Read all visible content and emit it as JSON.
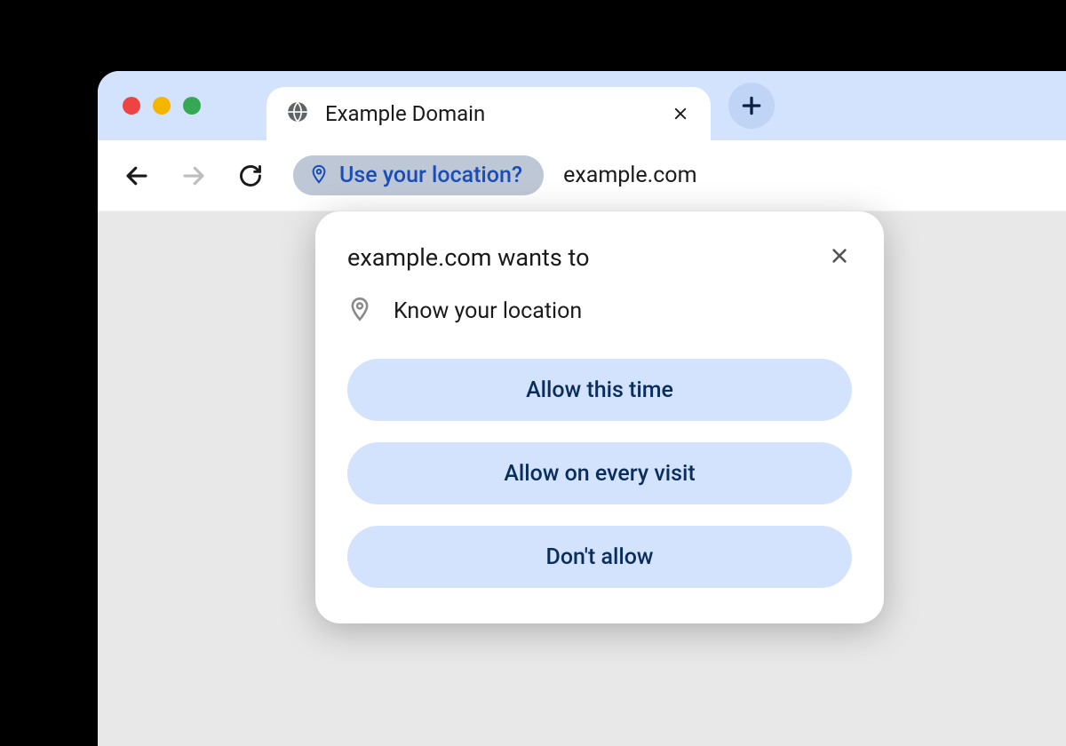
{
  "tab": {
    "title": "Example Domain"
  },
  "toolbar": {
    "location_chip": "Use your location?",
    "url": "example.com"
  },
  "popup": {
    "title": "example.com wants to",
    "permission_label": "Know your location",
    "buttons": {
      "allow_once": "Allow this time",
      "allow_always": "Allow on every visit",
      "deny": "Don't allow"
    }
  }
}
